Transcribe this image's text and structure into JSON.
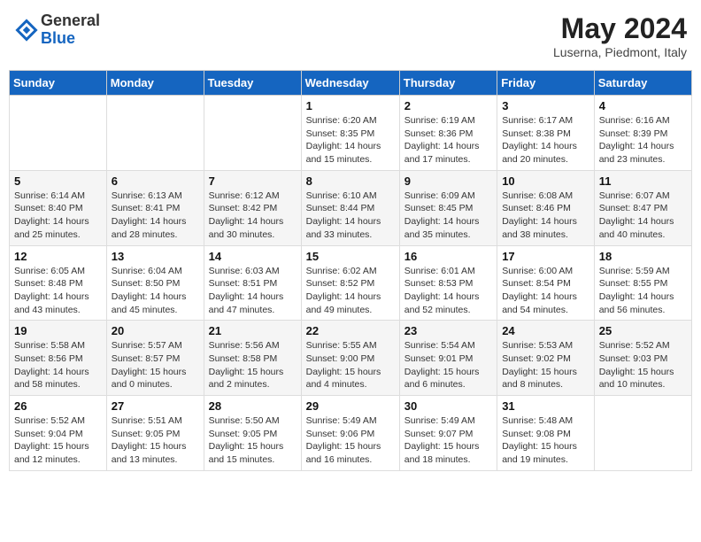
{
  "header": {
    "logo_general": "General",
    "logo_blue": "Blue",
    "month": "May 2024",
    "location": "Luserna, Piedmont, Italy"
  },
  "weekdays": [
    "Sunday",
    "Monday",
    "Tuesday",
    "Wednesday",
    "Thursday",
    "Friday",
    "Saturday"
  ],
  "weeks": [
    [
      {
        "day": "",
        "info": ""
      },
      {
        "day": "",
        "info": ""
      },
      {
        "day": "",
        "info": ""
      },
      {
        "day": "1",
        "info": "Sunrise: 6:20 AM\nSunset: 8:35 PM\nDaylight: 14 hours\nand 15 minutes."
      },
      {
        "day": "2",
        "info": "Sunrise: 6:19 AM\nSunset: 8:36 PM\nDaylight: 14 hours\nand 17 minutes."
      },
      {
        "day": "3",
        "info": "Sunrise: 6:17 AM\nSunset: 8:38 PM\nDaylight: 14 hours\nand 20 minutes."
      },
      {
        "day": "4",
        "info": "Sunrise: 6:16 AM\nSunset: 8:39 PM\nDaylight: 14 hours\nand 23 minutes."
      }
    ],
    [
      {
        "day": "5",
        "info": "Sunrise: 6:14 AM\nSunset: 8:40 PM\nDaylight: 14 hours\nand 25 minutes."
      },
      {
        "day": "6",
        "info": "Sunrise: 6:13 AM\nSunset: 8:41 PM\nDaylight: 14 hours\nand 28 minutes."
      },
      {
        "day": "7",
        "info": "Sunrise: 6:12 AM\nSunset: 8:42 PM\nDaylight: 14 hours\nand 30 minutes."
      },
      {
        "day": "8",
        "info": "Sunrise: 6:10 AM\nSunset: 8:44 PM\nDaylight: 14 hours\nand 33 minutes."
      },
      {
        "day": "9",
        "info": "Sunrise: 6:09 AM\nSunset: 8:45 PM\nDaylight: 14 hours\nand 35 minutes."
      },
      {
        "day": "10",
        "info": "Sunrise: 6:08 AM\nSunset: 8:46 PM\nDaylight: 14 hours\nand 38 minutes."
      },
      {
        "day": "11",
        "info": "Sunrise: 6:07 AM\nSunset: 8:47 PM\nDaylight: 14 hours\nand 40 minutes."
      }
    ],
    [
      {
        "day": "12",
        "info": "Sunrise: 6:05 AM\nSunset: 8:48 PM\nDaylight: 14 hours\nand 43 minutes."
      },
      {
        "day": "13",
        "info": "Sunrise: 6:04 AM\nSunset: 8:50 PM\nDaylight: 14 hours\nand 45 minutes."
      },
      {
        "day": "14",
        "info": "Sunrise: 6:03 AM\nSunset: 8:51 PM\nDaylight: 14 hours\nand 47 minutes."
      },
      {
        "day": "15",
        "info": "Sunrise: 6:02 AM\nSunset: 8:52 PM\nDaylight: 14 hours\nand 49 minutes."
      },
      {
        "day": "16",
        "info": "Sunrise: 6:01 AM\nSunset: 8:53 PM\nDaylight: 14 hours\nand 52 minutes."
      },
      {
        "day": "17",
        "info": "Sunrise: 6:00 AM\nSunset: 8:54 PM\nDaylight: 14 hours\nand 54 minutes."
      },
      {
        "day": "18",
        "info": "Sunrise: 5:59 AM\nSunset: 8:55 PM\nDaylight: 14 hours\nand 56 minutes."
      }
    ],
    [
      {
        "day": "19",
        "info": "Sunrise: 5:58 AM\nSunset: 8:56 PM\nDaylight: 14 hours\nand 58 minutes."
      },
      {
        "day": "20",
        "info": "Sunrise: 5:57 AM\nSunset: 8:57 PM\nDaylight: 15 hours\nand 0 minutes."
      },
      {
        "day": "21",
        "info": "Sunrise: 5:56 AM\nSunset: 8:58 PM\nDaylight: 15 hours\nand 2 minutes."
      },
      {
        "day": "22",
        "info": "Sunrise: 5:55 AM\nSunset: 9:00 PM\nDaylight: 15 hours\nand 4 minutes."
      },
      {
        "day": "23",
        "info": "Sunrise: 5:54 AM\nSunset: 9:01 PM\nDaylight: 15 hours\nand 6 minutes."
      },
      {
        "day": "24",
        "info": "Sunrise: 5:53 AM\nSunset: 9:02 PM\nDaylight: 15 hours\nand 8 minutes."
      },
      {
        "day": "25",
        "info": "Sunrise: 5:52 AM\nSunset: 9:03 PM\nDaylight: 15 hours\nand 10 minutes."
      }
    ],
    [
      {
        "day": "26",
        "info": "Sunrise: 5:52 AM\nSunset: 9:04 PM\nDaylight: 15 hours\nand 12 minutes."
      },
      {
        "day": "27",
        "info": "Sunrise: 5:51 AM\nSunset: 9:05 PM\nDaylight: 15 hours\nand 13 minutes."
      },
      {
        "day": "28",
        "info": "Sunrise: 5:50 AM\nSunset: 9:05 PM\nDaylight: 15 hours\nand 15 minutes."
      },
      {
        "day": "29",
        "info": "Sunrise: 5:49 AM\nSunset: 9:06 PM\nDaylight: 15 hours\nand 16 minutes."
      },
      {
        "day": "30",
        "info": "Sunrise: 5:49 AM\nSunset: 9:07 PM\nDaylight: 15 hours\nand 18 minutes."
      },
      {
        "day": "31",
        "info": "Sunrise: 5:48 AM\nSunset: 9:08 PM\nDaylight: 15 hours\nand 19 minutes."
      },
      {
        "day": "",
        "info": ""
      }
    ]
  ]
}
